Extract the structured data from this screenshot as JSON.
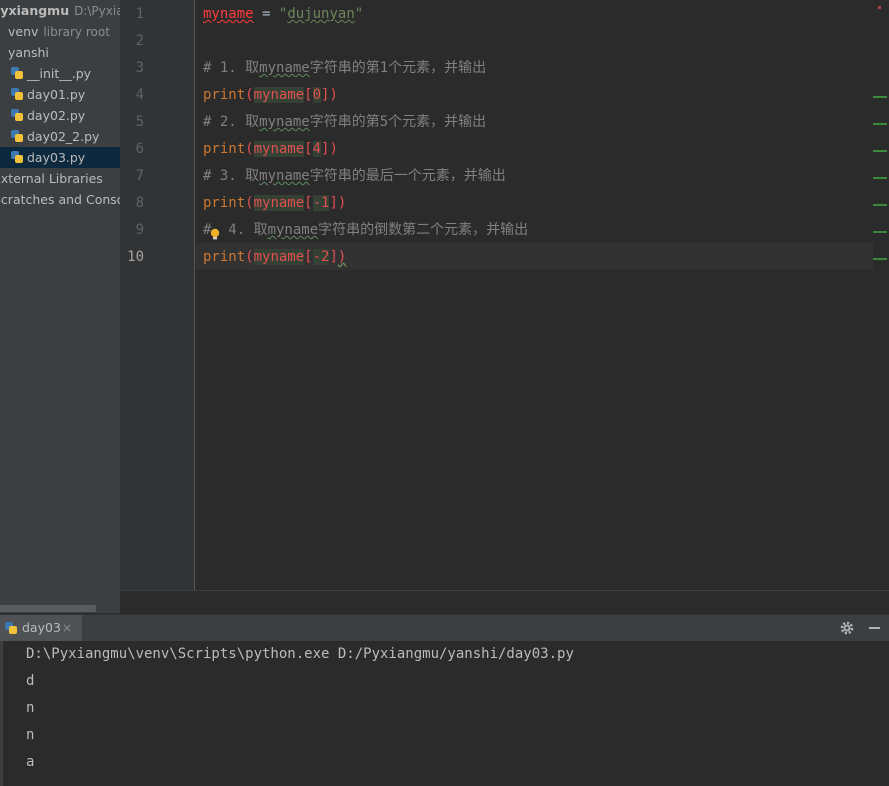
{
  "sidebar": {
    "project_name": "Pyxiangmu",
    "project_path": "D:\\Pyxiangmu",
    "items": [
      {
        "label": "venv",
        "note": "library root"
      },
      {
        "label": "yanshi"
      },
      {
        "label": "__init__.py"
      },
      {
        "label": "day01.py"
      },
      {
        "label": "day02.py"
      },
      {
        "label": "day02_2.py"
      },
      {
        "label": "day03.py"
      },
      {
        "label": "External Libraries"
      },
      {
        "label": "Scratches and Consoles"
      }
    ]
  },
  "editor": {
    "line_numbers": [
      "1",
      "2",
      "3",
      "4",
      "5",
      "6",
      "7",
      "8",
      "9",
      "10"
    ],
    "active_line": "10",
    "lines": {
      "l1": {
        "var": "myname",
        "op": " = ",
        "str_q1": "\"",
        "str_body": "dujunyan",
        "str_q2": "\""
      },
      "l3": {
        "c1": "# 1. 取",
        "c2": "myname",
        "c3": "字符串的第1个元素，并输出"
      },
      "l4": {
        "fn": "print",
        "open": "(",
        "var": "myname",
        "idx_open": "[",
        "idx": "0",
        "idx_close": "]",
        "close": ")"
      },
      "l5": {
        "c1": "# 2. 取",
        "c2": "myname",
        "c3": "字符串的第5个元素，并输出"
      },
      "l6": {
        "fn": "print",
        "open": "(",
        "var": "myname",
        "idx_open": "[",
        "idx": "4",
        "idx_close": "]",
        "close": ")"
      },
      "l7": {
        "c1": "# 3. 取",
        "c2": "myname",
        "c3": "字符串的最后一个元素，并输出"
      },
      "l8": {
        "fn": "print",
        "open": "(",
        "var": "myname",
        "idx_open": "[",
        "idx": "-1",
        "idx_close": "]",
        "close": ")"
      },
      "l9": {
        "c1": "#  4. 取",
        "c2": "myname",
        "c3": "字符串的倒数第二个元素，并输出"
      },
      "l10": {
        "fn": "print",
        "open": "(",
        "var": "myname",
        "idx_open": "[",
        "idx": "-2",
        "idx_close": "]",
        "close": ")"
      }
    }
  },
  "run": {
    "tab_label": "day03",
    "close_glyph": "×",
    "output": [
      "D:\\Pyxiangmu\\venv\\Scripts\\python.exe D:/Pyxiangmu/yanshi/day03.py",
      "d",
      "n",
      "n",
      "a"
    ]
  },
  "icons": {
    "python_file": "python-file-icon",
    "bulb": "lightbulb-icon",
    "gear": "gear-icon",
    "minimize": "minimize-icon"
  },
  "colors": {
    "editor_bg": "#2b2b2b",
    "sidebar_bg": "#3c3f41",
    "selection": "#0d293e",
    "comment": "#808080",
    "string": "#6a8759",
    "error": "#e05050"
  }
}
